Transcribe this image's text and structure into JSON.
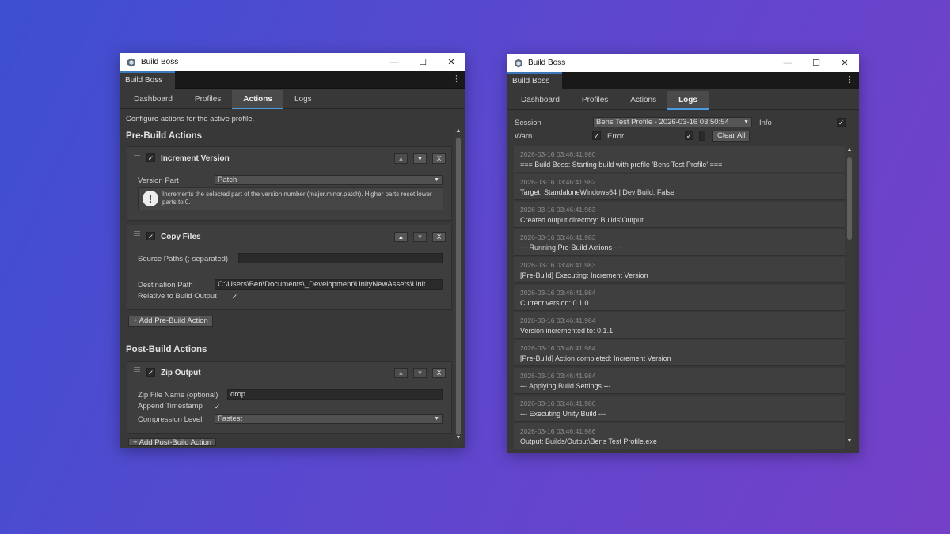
{
  "left": {
    "title": "Build Boss",
    "window_tab": "Build Boss",
    "tabs": [
      "Dashboard",
      "Profiles",
      "Actions",
      "Logs"
    ],
    "active_tab": "Actions",
    "description": "Configure actions for the active profile.",
    "pre_build_heading": "Pre-Build Actions",
    "post_build_heading": "Post-Build Actions",
    "increment": {
      "title": "Increment Version",
      "enabled": "✓",
      "version_part_label": "Version Part",
      "version_part_value": "Patch",
      "help_text": "Increments the selected part of the version number (major.minor.patch). Higher parts reset lower parts to 0."
    },
    "copy": {
      "title": "Copy Files",
      "enabled": "✓",
      "source_label": "Source Paths (;-separated)",
      "source_value": "",
      "dest_label": "Destination Path",
      "dest_value": "C:\\Users\\Ben\\Documents\\_Development\\UnityNewAssets\\Unit",
      "relative_label": "Relative to Build Output",
      "relative_value": "✓"
    },
    "add_pre_label": "+ Add Pre-Build Action",
    "zip": {
      "title": "Zip Output",
      "enabled": "✓",
      "name_label": "Zip File Name (optional)",
      "name_value": "drop",
      "timestamp_label": "Append Timestamp",
      "timestamp_value": "✓",
      "compression_label": "Compression Level",
      "compression_value": "Fastest"
    },
    "add_post_label": "+ Add Post-Build Action",
    "btn_up": "▲",
    "btn_down": "▼",
    "btn_remove": "X"
  },
  "right": {
    "title": "Build Boss",
    "window_tab": "Build Boss",
    "tabs": [
      "Dashboard",
      "Profiles",
      "Actions",
      "Logs"
    ],
    "active_tab": "Logs",
    "session_label": "Session",
    "session_value": "Bens Test Profile - 2026-03-16 03:50:54",
    "info_label": "Info",
    "info_value": "✓",
    "warn_label": "Warn",
    "warn_value": "✓",
    "error_label": "Error",
    "error_value": "✓",
    "clear_label": "Clear All",
    "logs": [
      {
        "ts": "2026-03-16 03:46:41.980",
        "msg": "=== Build Boss: Starting build with profile 'Bens Test Profile' ==="
      },
      {
        "ts": "2026-03-16 03:46:41.982",
        "msg": "Target: StandaloneWindows64 | Dev Build: False"
      },
      {
        "ts": "2026-03-16 03:46:41.983",
        "msg": "Created output directory: Builds\\Output"
      },
      {
        "ts": "2026-03-16 03:46:41.983",
        "msg": "--- Running Pre-Build Actions ---"
      },
      {
        "ts": "2026-03-16 03:46:41.983",
        "msg": "[Pre-Build] Executing: Increment Version"
      },
      {
        "ts": "2026-03-16 03:46:41.984",
        "msg": "Current version: 0.1.0"
      },
      {
        "ts": "2026-03-16 03:46:41.984",
        "msg": "Version incremented to: 0.1.1"
      },
      {
        "ts": "2026-03-16 03:46:41.984",
        "msg": "[Pre-Build] Action completed: Increment Version"
      },
      {
        "ts": "2026-03-16 03:46:41.984",
        "msg": "--- Applying Build Settings ---"
      },
      {
        "ts": "2026-03-16 03:46:41.986",
        "msg": "--- Executing Unity Build ---"
      },
      {
        "ts": "2026-03-16 03:46:41.986",
        "msg": "Output: Builds/Output\\Bens Test Profile.exe"
      }
    ]
  },
  "window_controls": {
    "minimize": "—",
    "maximize": "☐",
    "close": "✕"
  },
  "colors": {
    "accent": "#4b9be0",
    "window_bg": "#383838",
    "background_start": "#3d4fd0",
    "background_end": "#7540c8"
  }
}
